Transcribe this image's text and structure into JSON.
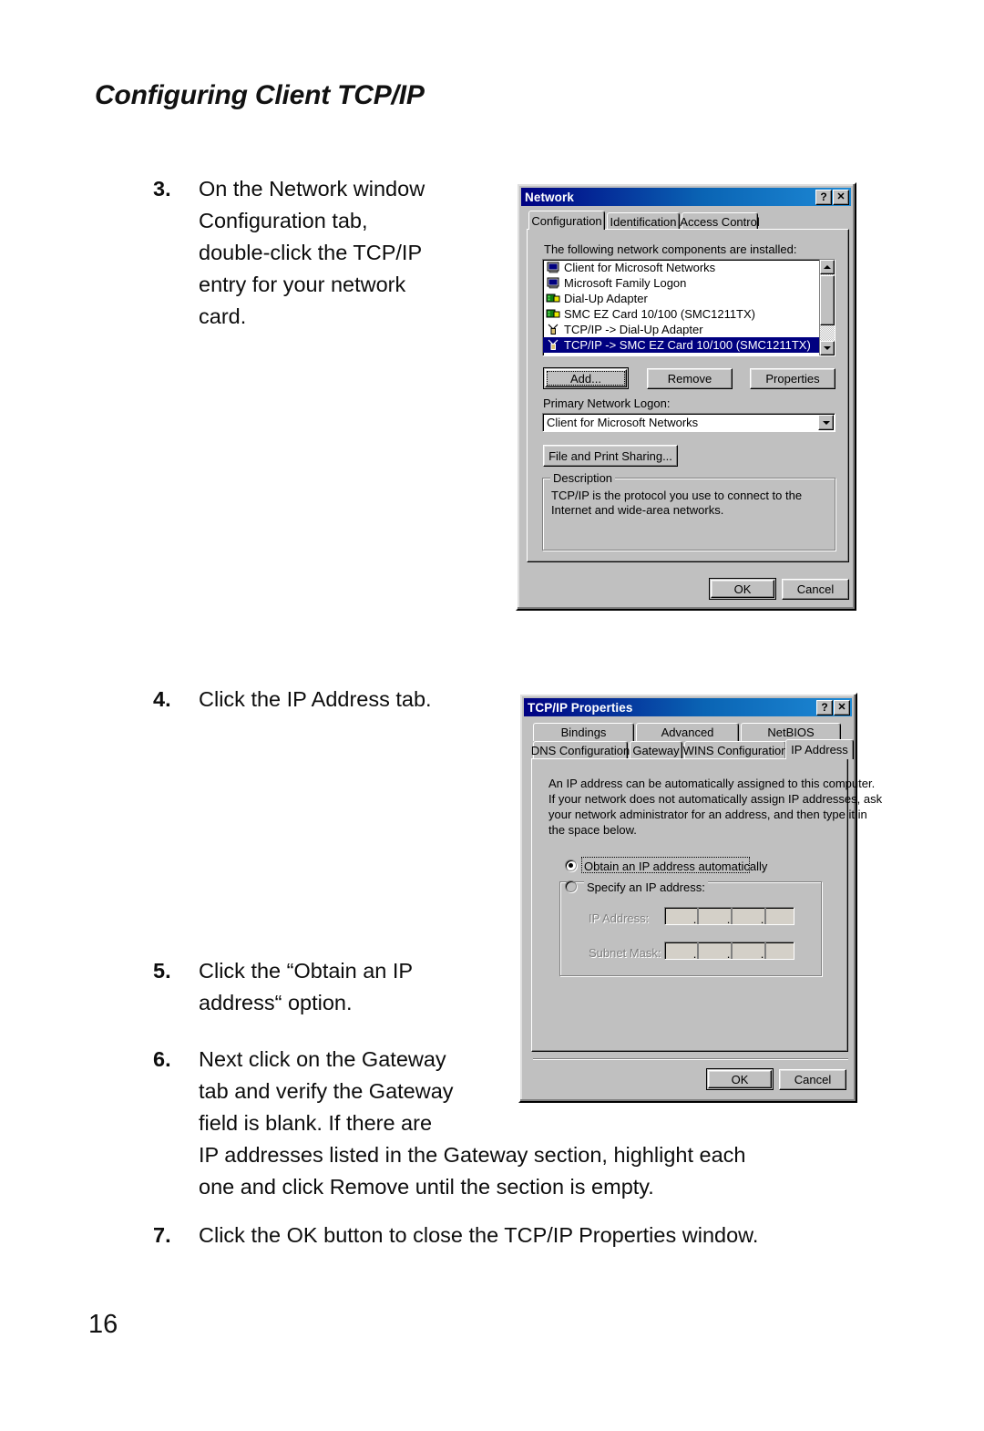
{
  "page": {
    "running_head": "Configuring Client TCP/IP",
    "folio": "16"
  },
  "steps": [
    {
      "number": "3.",
      "lines": [
        "On the Network window",
        "Configuration tab,",
        "double-click the TCP/IP",
        "entry for your network",
        "card."
      ]
    },
    {
      "number": "4.",
      "lines": [
        "Click the IP Address tab."
      ]
    },
    {
      "number": "5.",
      "lines": [
        "Click the “Obtain an IP",
        "address“ option."
      ]
    },
    {
      "number": "6.",
      "lines": [
        "Next click on the Gateway",
        "tab and verify the Gateway",
        "field is blank. If there are",
        "IP addresses listed in the Gateway section, highlight each",
        "one and click Remove until the section is empty."
      ]
    },
    {
      "number": "7.",
      "lines": [
        "Click the OK button to close the TCP/IP Properties window."
      ]
    }
  ],
  "network_dialog": {
    "title": "Network",
    "help_button": "?",
    "close_button": "✕",
    "tabs": [
      {
        "label": "Configuration",
        "active": true
      },
      {
        "label": "Identification",
        "active": false
      },
      {
        "label": "Access Control",
        "active": false
      }
    ],
    "list_caption": "The following network components are installed:",
    "components": [
      {
        "label": "Client for Microsoft Networks",
        "icon": "client-icon",
        "selected": false
      },
      {
        "label": "Microsoft Family Logon",
        "icon": "client-icon",
        "selected": false
      },
      {
        "label": "Dial-Up Adapter",
        "icon": "adapter-icon",
        "selected": false
      },
      {
        "label": "SMC EZ Card 10/100 (SMC1211TX)",
        "icon": "adapter-icon",
        "selected": false
      },
      {
        "label": "TCP/IP -> Dial-Up Adapter",
        "icon": "protocol-icon",
        "selected": false
      },
      {
        "label": "TCP/IP -> SMC EZ Card 10/100 (SMC1211TX)",
        "icon": "protocol-icon",
        "selected": true
      }
    ],
    "buttons": {
      "add": "Add...",
      "remove": "Remove",
      "properties": "Properties",
      "file_and_print_sharing": "File and Print Sharing..."
    },
    "primary_logon_label": "Primary Network Logon:",
    "primary_logon_value": "Client for Microsoft Networks",
    "description_caption": "Description",
    "description_text": "TCP/IP is the protocol you use to connect to the Internet and wide-area networks.",
    "ok_label": "OK",
    "cancel_label": "Cancel"
  },
  "tcpip_dialog": {
    "title": "TCP/IP Properties",
    "help_button": "?",
    "close_button": "✕",
    "tabs_row1": [
      {
        "label": "Bindings",
        "active": false
      },
      {
        "label": "Advanced",
        "active": false
      },
      {
        "label": "NetBIOS",
        "active": false
      }
    ],
    "tabs_row2": [
      {
        "label": "DNS Configuration",
        "active": false
      },
      {
        "label": "Gateway",
        "active": false
      },
      {
        "label": "WINS Configuration",
        "active": false
      },
      {
        "label": "IP Address",
        "active": true
      }
    ],
    "help_lines": [
      "An IP address can be automatically assigned to this computer.",
      "If your network does not automatically assign IP addresses, ask",
      "your network administrator for an address, and then type it in",
      "the space below."
    ],
    "radio_obtain": "Obtain an IP address automatically",
    "radio_obtain_selected": true,
    "group_specify": "Specify an IP address:",
    "ip_address_label": "IP Address:",
    "subnet_mask_label": "Subnet Mask:",
    "ip_address_value": "",
    "subnet_mask_value": "",
    "octet_separator": ".",
    "ok_label": "OK",
    "cancel_label": "Cancel"
  },
  "colors": {
    "title_bar_start": "#000082",
    "title_bar_end": "#1e8ad6",
    "face": "#c0c0c0",
    "selection": "#000080",
    "disabled_text": "#808080"
  }
}
